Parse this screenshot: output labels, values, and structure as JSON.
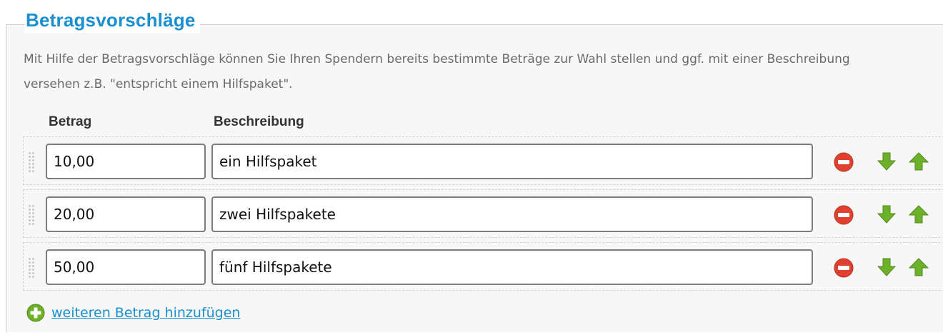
{
  "section": {
    "title": "Betragsvorschläge",
    "description": "Mit Hilfe der Betragsvorschläge können Sie Ihren Spendern bereits bestimmte Beträge zur Wahl stellen und ggf. mit einer Beschreibung versehen z.B. \"entspricht einem Hilfspaket\"."
  },
  "columns": {
    "amount": "Betrag",
    "description": "Beschreibung"
  },
  "rows": [
    {
      "amount": "10,00",
      "description": "ein Hilfspaket"
    },
    {
      "amount": "20,00",
      "description": "zwei Hilfspakete"
    },
    {
      "amount": "50,00",
      "description": "fünf Hilfspakete"
    }
  ],
  "icons": {
    "remove": "remove-icon",
    "move_down": "arrow-down-icon",
    "move_up": "arrow-up-icon",
    "add": "plus-circle-icon",
    "drag": "drag-handle-icon"
  },
  "colors": {
    "accent": "#1a8fd0",
    "remove_red": "#e0412f",
    "arrow_green": "#6db02a"
  },
  "add_link": {
    "label": "weiteren Betrag hinzufügen"
  }
}
